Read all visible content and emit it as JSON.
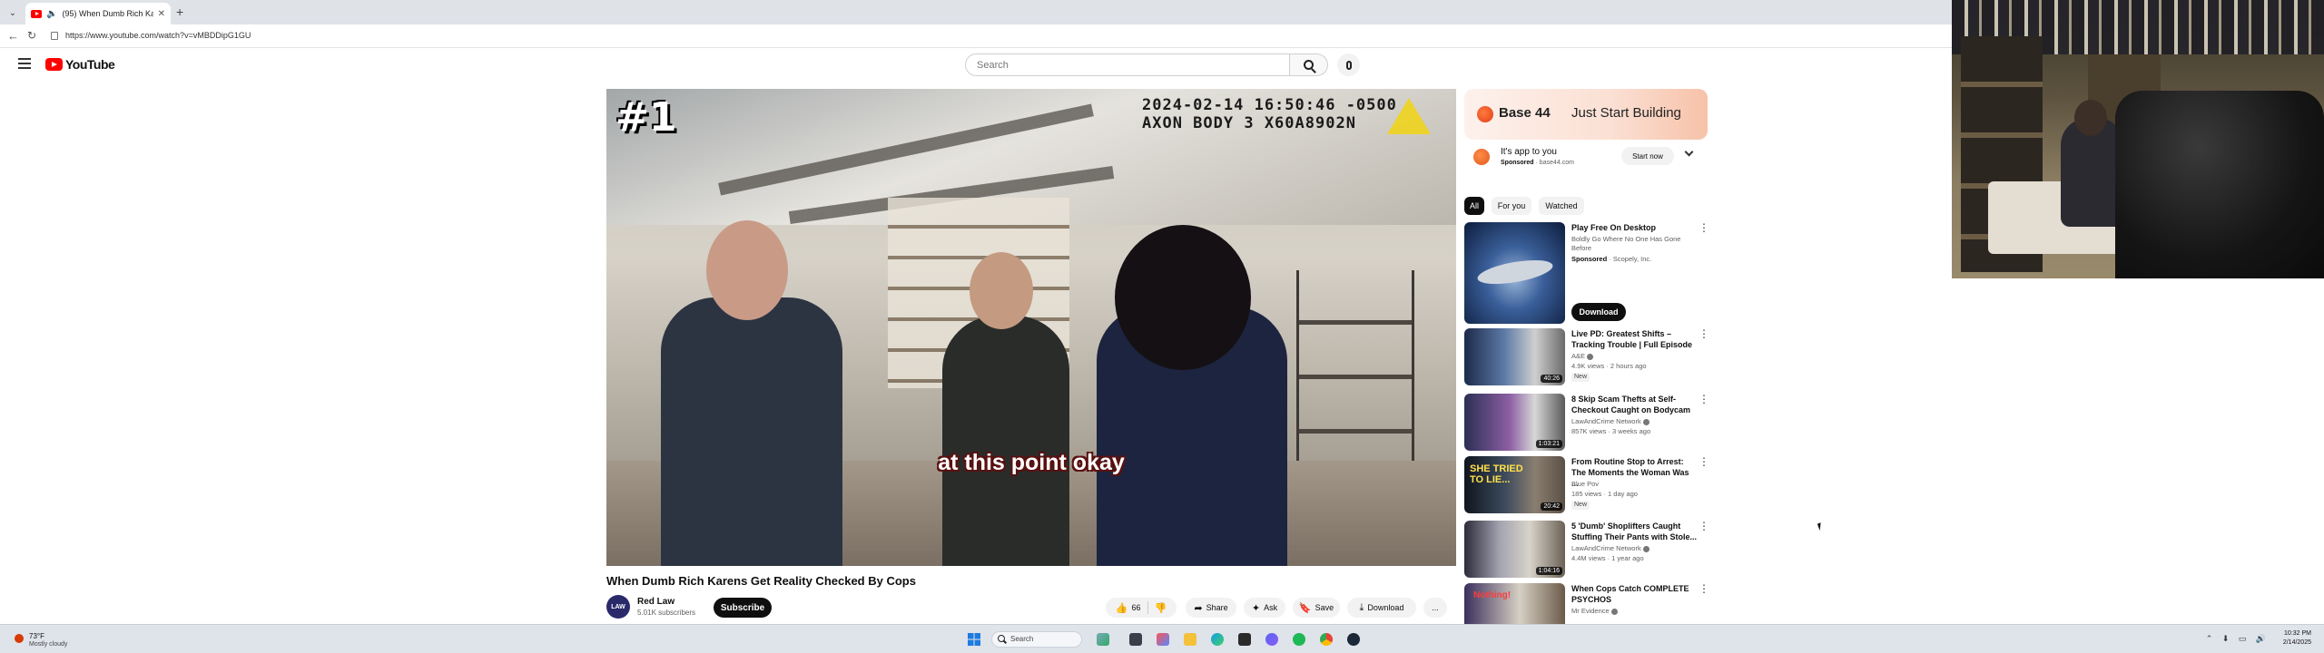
{
  "browser": {
    "tab": {
      "title": "(95) When Dumb Rich Karen"
    },
    "url": "https://www.youtube.com/watch?v=vMBDDipG1GU"
  },
  "masthead": {
    "logo_text": "YouTube",
    "search_placeholder": "Search"
  },
  "player": {
    "rank_badge": "#1",
    "timestamp_line1": "2024-02-14 16:50:46 -0500",
    "timestamp_line2": "AXON BODY 3 X60A8902N",
    "caption": "at this point okay"
  },
  "video": {
    "title": "When Dumb Rich Karens Get Reality Checked By Cops",
    "channel": {
      "name": "Red Law",
      "subscribers": "5.01K subscribers",
      "avatar_text": "LAW"
    },
    "subscribe_label": "Subscribe",
    "actions": {
      "likes": "66",
      "share": "Share",
      "ask": "Ask",
      "save": "Save",
      "download": "Download",
      "more": "..."
    }
  },
  "sidebar": {
    "ad": {
      "brand": "Base 44",
      "tagline": "Just Start Building",
      "row_title": "It's app to you",
      "sponsored": "Sponsored",
      "domain": "base44.com",
      "cta": "Start now"
    },
    "chips": [
      "All",
      "For you",
      "Watched"
    ],
    "recommendations": [
      {
        "title": "Play Free On Desktop",
        "line2": "Boldly Go Where No One Has Gone",
        "line3": "Before",
        "sponsored": "Sponsored",
        "advertiser": "Scopely, Inc.",
        "cta": "Download",
        "duration": ""
      },
      {
        "title": "Live PD: Greatest Shifts – Tracking Trouble | Full Episode",
        "channel": "A&E",
        "meta": "4.9K views · 2 hours ago",
        "tag": "New",
        "duration": "40:26"
      },
      {
        "title": "8 Skip Scam Thefts at Self-Checkout Caught on Bodycam",
        "channel": "LawAndCrime Network",
        "meta": "857K views · 3 weeks ago",
        "tag": "",
        "duration": "1:03:21"
      },
      {
        "title": "From Routine Stop to Arrest: The Moments the Woman Was ...",
        "channel": "Blue Pov",
        "meta": "185 views · 1 day ago",
        "tag": "New",
        "duration": "20:42"
      },
      {
        "title": "5 'Dumb' Shoplifters Caught Stuffing Their Pants with Stole...",
        "channel": "LawAndCrime Network",
        "meta": "4.4M views · 1 year ago",
        "tag": "",
        "duration": "1:04:16"
      },
      {
        "title": "When Cops Catch COMPLETE PSYCHOS",
        "channel": "Mr Evidence",
        "meta": "",
        "tag": "",
        "duration": ""
      }
    ]
  },
  "taskbar": {
    "weather_temp": "73°F",
    "weather_desc": "Mostly cloudy",
    "search_label": "Search",
    "time": "10:32 PM",
    "date": "2/14/2025"
  },
  "colors": {
    "youtube_red": "#ff0000",
    "subscribe_bg": "#0f0f0f",
    "ad_gradient_end": "#f6c2a8"
  }
}
